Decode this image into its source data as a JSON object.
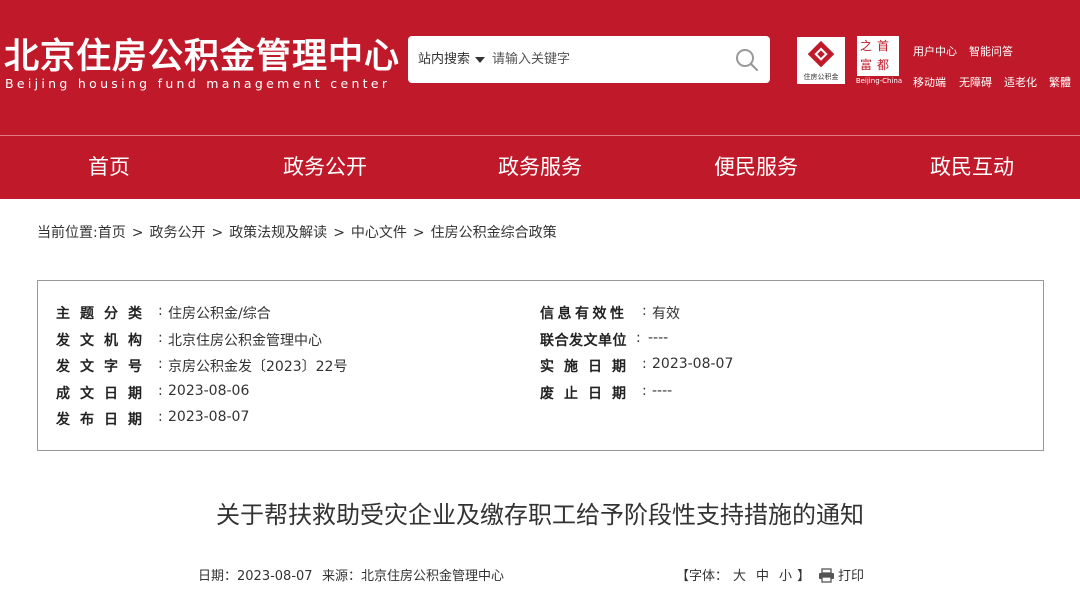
{
  "header": {
    "title": "北京住房公积金管理中心",
    "subtitle": "Beijing housing fund management center",
    "search": {
      "scope": "站内搜索",
      "placeholder": "请输入关键字"
    },
    "emblem_text": "住房公积金",
    "capital_chars": [
      "之",
      "首",
      "富",
      "都"
    ],
    "capital_label": "Beijing-China",
    "links_row1": [
      "用户中心",
      "智能问答"
    ],
    "links_row2": [
      "移动端",
      "无障碍",
      "适老化",
      "繁體"
    ]
  },
  "nav": [
    "首页",
    "政务公开",
    "政务服务",
    "便民服务",
    "政民互动"
  ],
  "breadcrumb": {
    "prefix": "当前位置:",
    "items": [
      "首页",
      "政务公开",
      "政策法规及解读",
      "中心文件",
      "住房公积金综合政策"
    ]
  },
  "info": {
    "left": [
      {
        "label": "主题分类",
        "value": "住房公积金/综合"
      },
      {
        "label": "发文机构",
        "value": "北京住房公积金管理中心"
      },
      {
        "label": "发文字号",
        "value": "京房公积金发〔2023〕22号"
      },
      {
        "label": "成文日期",
        "value": "2023-08-06"
      },
      {
        "label": "发布日期",
        "value": "2023-08-07"
      }
    ],
    "right": [
      {
        "label": "信息有效性",
        "value": "有效"
      },
      {
        "label": "联合发文单位",
        "value": "----"
      },
      {
        "label": "实施日期",
        "value": "2023-08-07"
      },
      {
        "label": "废止日期",
        "value": "----"
      }
    ]
  },
  "article": {
    "title": "关于帮扶救助受灾企业及缴存职工给予阶段性支持措施的通知",
    "date_text": "日期：2023-08-07",
    "source_text": "来源：北京住房公积金管理中心",
    "font_label": "【字体：",
    "font_sizes": [
      "大",
      "中",
      "小"
    ],
    "font_end": "】",
    "print_label": "打印"
  },
  "colors": {
    "brand_red": "#c0192a"
  }
}
